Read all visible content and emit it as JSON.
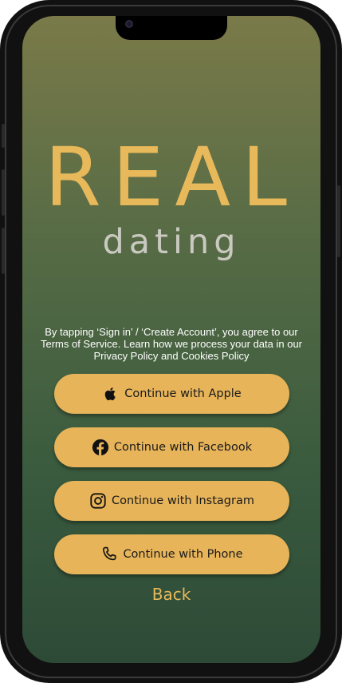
{
  "app": {
    "logo_title": "REAL",
    "logo_subtitle": "dating"
  },
  "terms": {
    "text": "By tapping ‘Sign in’ / ‘Create Account’, you agree to our Terms of Service. Learn how we process your data in our Privacy Policy and Cookies Policy"
  },
  "buttons": [
    {
      "label": "Continue with Apple",
      "icon": "apple-icon"
    },
    {
      "label": "Continue with Facebook",
      "icon": "facebook-icon"
    },
    {
      "label": "Continue with Instagram",
      "icon": "instagram-icon"
    },
    {
      "label": "Continue with Phone",
      "icon": "phone-icon"
    }
  ],
  "back_label": "Back",
  "colors": {
    "accent": "#e8b95a",
    "button_bg": "#e7b45a",
    "subtitle": "#c9c9c0",
    "gradient_top": "#7a7a49",
    "gradient_bottom": "#2d4a37"
  }
}
